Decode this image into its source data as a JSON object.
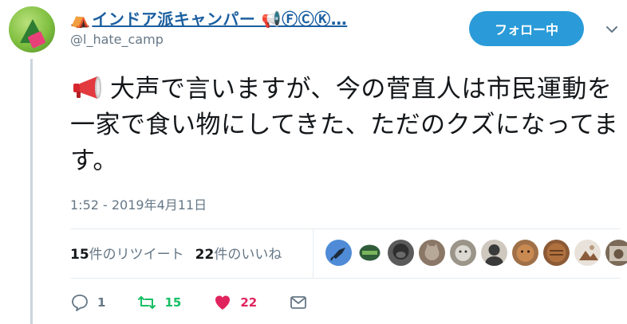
{
  "author": {
    "display_name_prefix": "⛺",
    "display_name": "インドア派キャンパー 📢ⒻⒸⓀ…",
    "handle": "@l_hate_camp"
  },
  "follow_button": {
    "label": "フォロー中"
  },
  "tweet": {
    "text": "大声で言いますが、今の菅直人は市民運動を一家で食い物にしてきた、ただのクズになってます。",
    "timestamp": "1:52 - 2019年4月11日"
  },
  "stats": {
    "retweet_count": "15",
    "retweet_label": "件のリツイート",
    "like_count": "22",
    "like_label": "件のいいね"
  },
  "likers": [
    {
      "icon": "bird-avatar",
      "color": "#4f8bd6"
    },
    {
      "icon": "green-logo-avatar",
      "color": "#2f5d3a"
    },
    {
      "icon": "gorilla-avatar",
      "color": "#5b5b5b"
    },
    {
      "icon": "cat-avatar",
      "color": "#8a7766"
    },
    {
      "icon": "dog-avatar",
      "color": "#9a9489"
    },
    {
      "icon": "person-avatar",
      "color": "#cfc8be"
    },
    {
      "icon": "cat-face-avatar",
      "color": "#a07048"
    },
    {
      "icon": "tabby-cat-avatar",
      "color": "#8c5a36"
    },
    {
      "icon": "photo-avatar",
      "color": "#b79a7e"
    },
    {
      "icon": "cat-photo-avatar",
      "color": "#7b6a58"
    }
  ],
  "actions": {
    "reply_count": "1",
    "retweet_count": "15",
    "like_count": "22"
  },
  "colors": {
    "accent": "#2a9bd8",
    "retweet": "#17bf63",
    "like": "#e0245e",
    "muted": "#657786"
  }
}
